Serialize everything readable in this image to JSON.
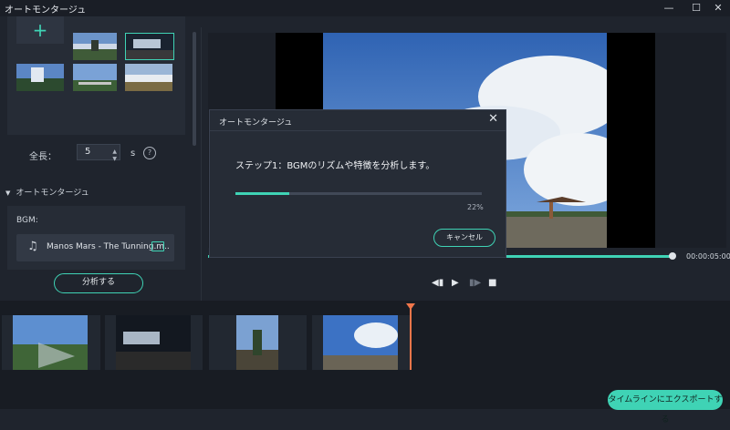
{
  "window": {
    "title": "オートモンタージュ",
    "minimize": "—",
    "maximize": "☐",
    "close": "✕"
  },
  "left": {
    "add_tile": "+",
    "length_label": "全長：",
    "length_value": "5",
    "length_unit": "s",
    "help": "?",
    "section_title": "オートモンタージュ",
    "bgm_label": "BGM:",
    "bgm_file": "Manos Mars - The Tunning.m..",
    "analyze_button": "分析する"
  },
  "preview": {
    "timecode": "00:00:05:00",
    "controls": {
      "prev": "◀▮",
      "play": "▶",
      "next": "▮▶",
      "stop": "■"
    },
    "progress_fraction": 0.99
  },
  "dialog": {
    "title": "オートモンタージュ",
    "close": "✕",
    "message": "ステップ1：BGMのリズムや特徴を分析します。",
    "progress_percent": 22,
    "progress_text": "22%",
    "cancel_button": "キャンセル"
  },
  "footer": {
    "export_button": "タイムラインにエクスポートする"
  },
  "colors": {
    "accent": "#3fd3b5",
    "playhead": "#f0764a"
  }
}
